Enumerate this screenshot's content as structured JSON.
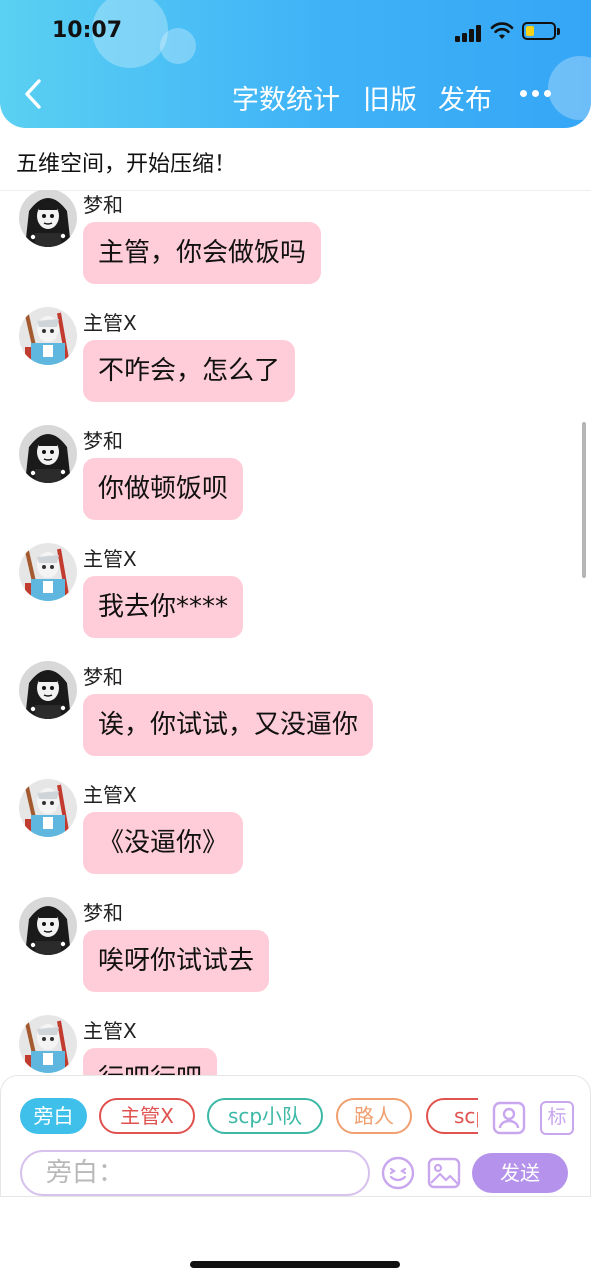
{
  "status_bar": {
    "time": "10:07"
  },
  "header": {
    "word_count_label": "字数统计",
    "old_version_label": "旧版",
    "publish_label": "发布"
  },
  "story": {
    "title": "五维空间，开始压缩！"
  },
  "messages": [
    {
      "sender": "梦和",
      "text": "主管，你会做饭吗"
    },
    {
      "sender": "主管X",
      "text": "不咋会，怎么了"
    },
    {
      "sender": "梦和",
      "text": "你做顿饭呗"
    },
    {
      "sender": "主管X",
      "text": "我去你****"
    },
    {
      "sender": "梦和",
      "text": "诶，你试试，又没逼你"
    },
    {
      "sender": "主管X",
      "text": "《没逼你》"
    },
    {
      "sender": "梦和",
      "text": "唉呀你试试去"
    },
    {
      "sender": "主管X",
      "text": "行吧行吧"
    }
  ],
  "roles": [
    {
      "label": "旁白",
      "color": "#3ec0ea",
      "selected": true
    },
    {
      "label": "主管X",
      "color": "#e0524f",
      "selected": false
    },
    {
      "label": "scp小队",
      "color": "#3cb8a6",
      "selected": false
    },
    {
      "label": "路人",
      "color": "#f0a070",
      "selected": false
    },
    {
      "label": "scp",
      "color": "#e0524f",
      "selected": false
    }
  ],
  "toolbar": {
    "tag_label": "标"
  },
  "composer": {
    "placeholder": "旁白：",
    "send_label": "发送"
  },
  "icons": {
    "back": "chevron-left-icon",
    "more": "more-dots-icon",
    "role_manage": "person-card-icon",
    "emoji": "emoji-icon",
    "image": "image-icon"
  },
  "colors": {
    "header_blue": "#3fb2f7",
    "bubble_pink": "#ffccd9",
    "send_purple": "#b592eb"
  }
}
